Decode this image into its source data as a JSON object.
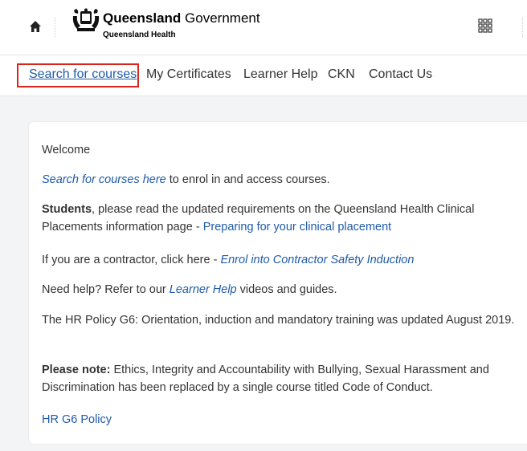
{
  "header": {
    "brand_bold": "Queensland",
    "brand_rest": " Government",
    "brand_sub": "Queensland Health",
    "icons": [
      "home-icon",
      "crest-logo",
      "apps-grid-icon"
    ]
  },
  "nav": {
    "items": [
      {
        "label": "Search for courses",
        "active": true
      },
      {
        "label": "My Certificates"
      },
      {
        "label": "Learner Help"
      },
      {
        "label": "CKN"
      },
      {
        "label": "Contact Us"
      }
    ]
  },
  "content": {
    "welcome": "Welcome",
    "search_link": "Search for courses here",
    "search_rest": " to enrol in and access courses.",
    "students_bold": "Students",
    "students_text": ", please read the updated requirements on the Queensland Health Clinical Placements information page - ",
    "students_link": "Preparing for your clinical placement",
    "contractor_text": "If you are a contractor, click here - ",
    "contractor_link": "Enrol into Contractor Safety Induction",
    "help_text_1": "Need help? Refer to our ",
    "help_link": "Learner Help",
    "help_text_2": " videos and guides.",
    "policy_text": "The HR Policy G6: Orientation, induction and mandatory training was updated August 2019.",
    "note_bold": "Please note:",
    "note_text": " Ethics, Integrity and Accountability with Bullying, Sexual Harassment and Discrimination has been replaced by a single course titled Code of Conduct.",
    "hr_link": "HR G6 Policy"
  },
  "colors": {
    "link": "#1f5aa8",
    "highlight_border": "#d9261c",
    "background": "#f3f4f6"
  }
}
